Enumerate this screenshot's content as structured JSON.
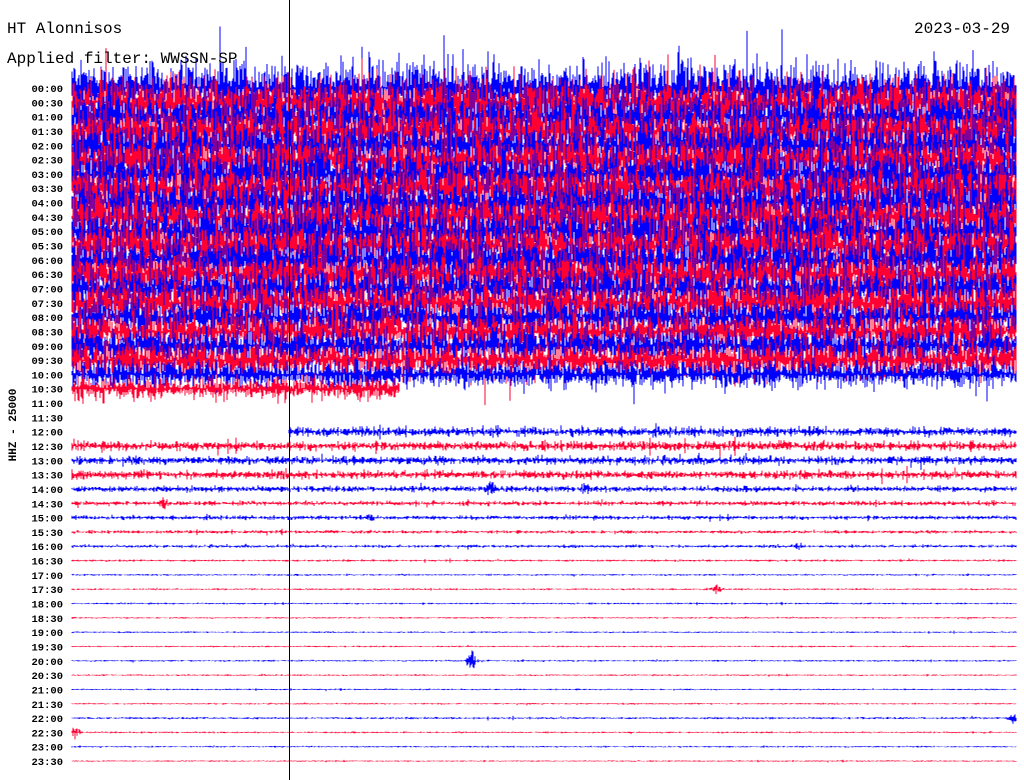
{
  "header": {
    "station": "HT Alonnisos",
    "filter": "Applied filter: WWSSN-SP",
    "date": "2023-03-29"
  },
  "chart_data": {
    "type": "line",
    "subtype": "helicorder",
    "channel_label": "HHZ - 25000",
    "minutes_per_row": 30,
    "colors": {
      "hour": "#0000ff",
      "half_hour": "#ff0033",
      "marker": "#000000"
    },
    "time_marker_minute": 6.9,
    "rows": [
      {
        "label": "00:00",
        "amp": 2.6
      },
      {
        "label": "00:30",
        "amp": 2.6
      },
      {
        "label": "01:00",
        "amp": 2.6
      },
      {
        "label": "01:30",
        "amp": 2.6
      },
      {
        "label": "02:00",
        "amp": 2.6
      },
      {
        "label": "02:30",
        "amp": 2.6
      },
      {
        "label": "03:00",
        "amp": 2.6
      },
      {
        "label": "03:30",
        "amp": 2.6
      },
      {
        "label": "04:00",
        "amp": 2.6
      },
      {
        "label": "04:30",
        "amp": 2.6
      },
      {
        "label": "05:00",
        "amp": 2.6
      },
      {
        "label": "05:30",
        "amp": 2.6
      },
      {
        "label": "06:00",
        "amp": 2.6
      },
      {
        "label": "06:30",
        "amp": 2.4
      },
      {
        "label": "07:00",
        "amp": 2.2
      },
      {
        "label": "07:30",
        "amp": 2.4
      },
      {
        "label": "08:00",
        "amp": 2.0
      },
      {
        "label": "08:30",
        "amp": 2.0
      },
      {
        "label": "09:00",
        "amp": 2.0
      },
      {
        "label": "09:30",
        "amp": 1.9
      },
      {
        "label": "10:00",
        "amp": 1.4
      },
      {
        "label": "10:30",
        "amp": 1.1,
        "end": 10.4
      },
      {
        "label": "11:00",
        "amp": 0,
        "end": 0
      },
      {
        "label": "11:30",
        "amp": 0,
        "end": 0
      },
      {
        "label": "12:00",
        "amp": 0.45,
        "start": 6.9
      },
      {
        "label": "12:30",
        "amp": 0.45
      },
      {
        "label": "13:00",
        "amp": 0.4
      },
      {
        "label": "13:30",
        "amp": 0.4
      },
      {
        "label": "14:00",
        "amp": 0.28,
        "events": [
          {
            "minute": 13.3,
            "amp": 0.9
          },
          {
            "minute": 16.3,
            "amp": 0.7
          }
        ]
      },
      {
        "label": "14:30",
        "amp": 0.22,
        "events": [
          {
            "minute": 2.9,
            "amp": 0.8
          }
        ]
      },
      {
        "label": "15:00",
        "amp": 0.2,
        "events": [
          {
            "minute": 9.5,
            "amp": 0.4
          }
        ]
      },
      {
        "label": "15:30",
        "amp": 0.15
      },
      {
        "label": "16:00",
        "amp": 0.14,
        "events": [
          {
            "minute": 23.1,
            "amp": 0.4
          }
        ]
      },
      {
        "label": "16:30",
        "amp": 0.1
      },
      {
        "label": "17:00",
        "amp": 0.08
      },
      {
        "label": "17:30",
        "amp": 0.08,
        "events": [
          {
            "minute": 20.5,
            "amp": 0.45
          }
        ]
      },
      {
        "label": "18:00",
        "amp": 0.08
      },
      {
        "label": "18:30",
        "amp": 0.07
      },
      {
        "label": "19:00",
        "amp": 0.07
      },
      {
        "label": "19:30",
        "amp": 0.07
      },
      {
        "label": "20:00",
        "amp": 0.08,
        "events": [
          {
            "minute": 12.7,
            "amp": 0.9
          }
        ]
      },
      {
        "label": "20:30",
        "amp": 0.07
      },
      {
        "label": "21:00",
        "amp": 0.07
      },
      {
        "label": "21:30",
        "amp": 0.07
      },
      {
        "label": "22:00",
        "amp": 0.1,
        "events": [
          {
            "minute": 29.9,
            "amp": 0.5
          }
        ]
      },
      {
        "label": "22:30",
        "amp": 0.08,
        "events": [
          {
            "minute": 0.1,
            "amp": 0.6
          }
        ]
      },
      {
        "label": "23:00",
        "amp": 0.07
      },
      {
        "label": "23:30",
        "amp": 0.06
      }
    ]
  }
}
